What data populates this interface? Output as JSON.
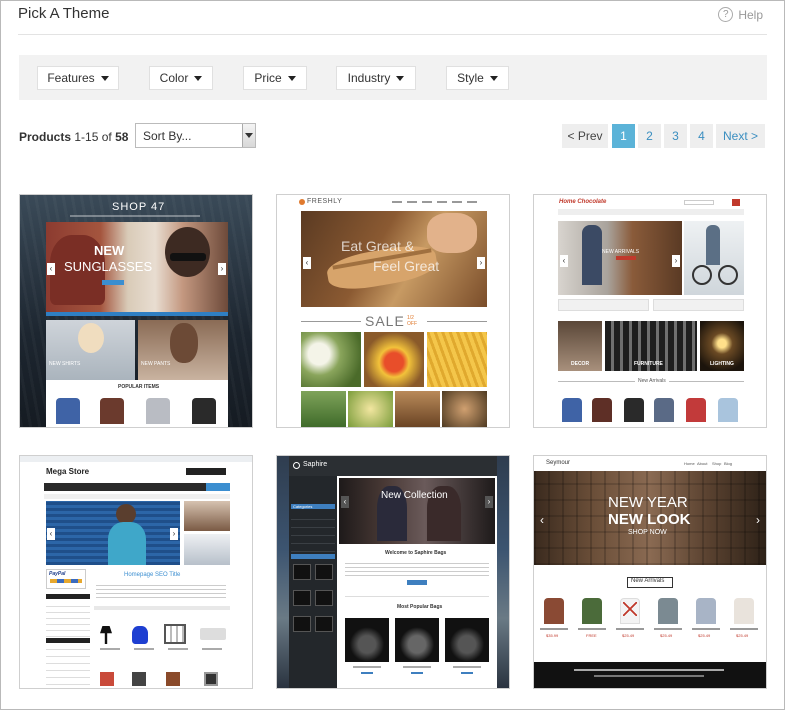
{
  "header": {
    "title": "Pick A Theme",
    "help_label": "Help",
    "help_icon": "?"
  },
  "filters": [
    {
      "label": "Features"
    },
    {
      "label": "Color"
    },
    {
      "label": "Price"
    },
    {
      "label": "Industry"
    },
    {
      "label": "Style"
    }
  ],
  "toolbar": {
    "products_label": "Products",
    "products_range": "1-15 of",
    "products_total": "58",
    "sort_placeholder": "Sort By..."
  },
  "pagination": {
    "prev": "< Prev",
    "pages": [
      "1",
      "2",
      "3",
      "4"
    ],
    "active_page": "1",
    "next": "Next >"
  },
  "themes": [
    {
      "logo": "SHOP 47",
      "hero_line1": "NEW",
      "hero_line2": "SUNGLASSES",
      "tile1": "NEW SHIRTS",
      "tile2": "NEW PANTS",
      "section": "POPULAR ITEMS"
    },
    {
      "logo": "FRESHLY",
      "hero_line1": "Eat Great &",
      "hero_line2": "Feel Great",
      "sale": "SALE",
      "sale_badge": "1/2 OFF"
    },
    {
      "logo": "Home Chocolate",
      "banner": "NEW ARRIVALS",
      "tile1": "DECOR",
      "tile2": "FURNITURE",
      "tile3": "LIGHTING",
      "section": "New Arrivals"
    },
    {
      "logo": "Mega Store",
      "seo_title": "Homepage SEO Title",
      "paypal": "PayPal"
    },
    {
      "logo": "Saphire",
      "hero": "New Collection",
      "welcome": "Welcome to Saphire Bags",
      "section": "Most Popular Bags",
      "categories": "Categories"
    },
    {
      "logo": "Seymour",
      "nav": [
        "Home",
        "About",
        "Shop",
        "Blog"
      ],
      "hero_line1": "NEW YEAR",
      "hero_line2": "NEW LOOK",
      "hero_line3": "SHOP NOW",
      "section": "New Arrivals",
      "prices": [
        "$35.99",
        "FREE",
        "$25.49",
        "$25.49",
        "$25.49",
        "$25.49"
      ]
    }
  ]
}
